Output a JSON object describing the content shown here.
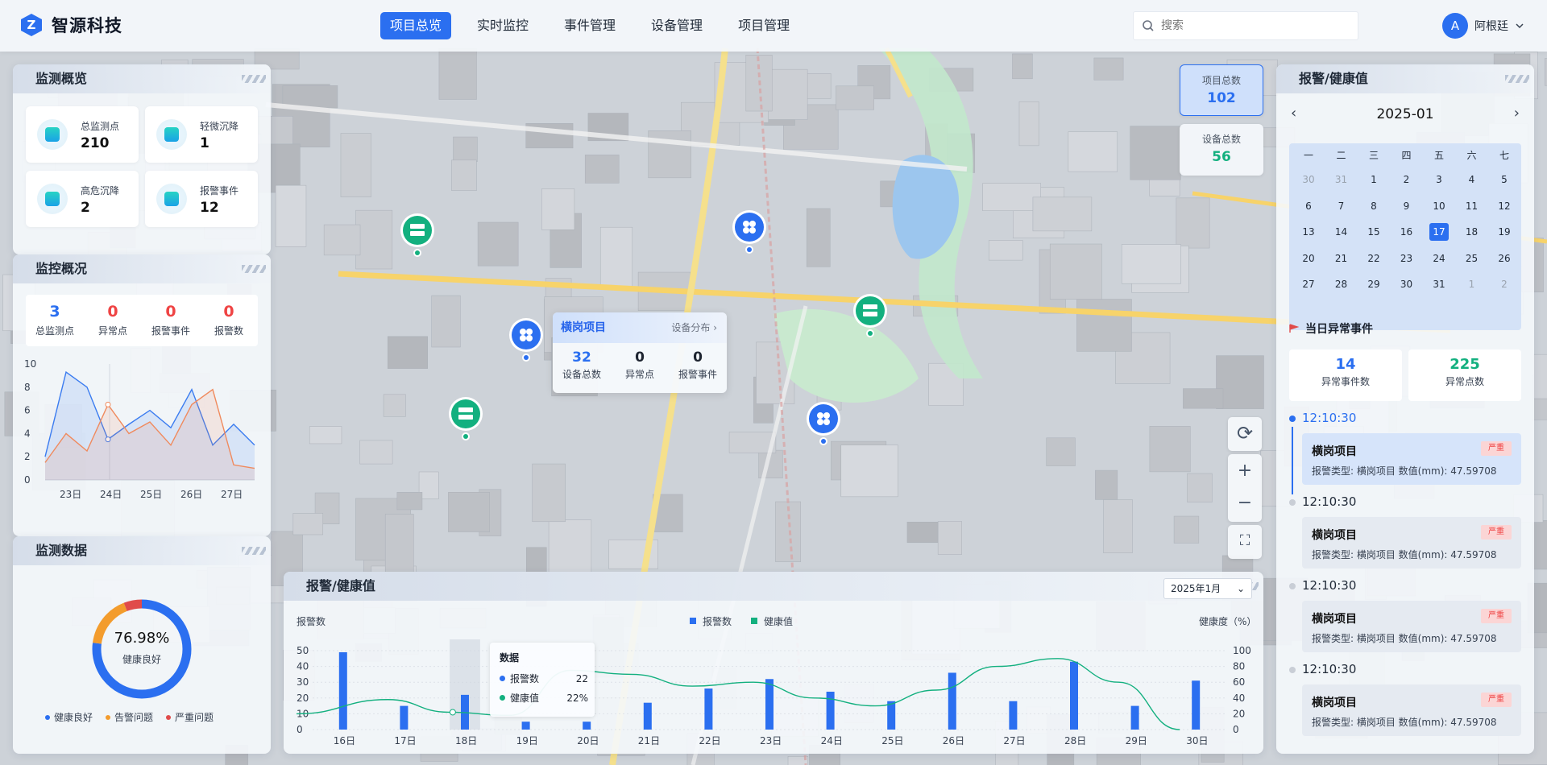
{
  "header": {
    "logo_letter": "Z",
    "app_name": "智源科技",
    "search_placeholder": "搜索",
    "user_initial": "A",
    "user_name": "阿根廷",
    "nav": [
      "项目总览",
      "实时监控",
      "事件管理",
      "设备管理",
      "项目管理"
    ],
    "active_nav": 0
  },
  "overview": {
    "title": "监测概览",
    "cards": [
      {
        "label": "总监测点",
        "value": "210"
      },
      {
        "label": "轻微沉降",
        "value": "1"
      },
      {
        "label": "高危沉降",
        "value": "2"
      },
      {
        "label": "报警事件",
        "value": "12"
      }
    ]
  },
  "monitor": {
    "title": "监控概况",
    "stats": [
      {
        "value": "3",
        "label": "总监测点",
        "color": "#2b6ff0"
      },
      {
        "value": "0",
        "label": "异常点",
        "color": "#ef4444"
      },
      {
        "value": "0",
        "label": "报警事件",
        "color": "#ef4444"
      },
      {
        "value": "0",
        "label": "报警数",
        "color": "#ef4444"
      }
    ],
    "chart": {
      "type": "line",
      "x": [
        "23日",
        "24日",
        "25日",
        "26日",
        "27日"
      ],
      "y_ticks": [
        "10",
        "8",
        "6",
        "4",
        "2",
        "0"
      ],
      "series": [
        {
          "color": "#3b7cf0",
          "values": [
            2,
            9.3,
            8,
            3.5,
            4.8,
            6,
            4.5,
            7.8,
            3,
            4.8,
            3
          ]
        },
        {
          "color": "#f08a5d",
          "values": [
            1.5,
            4,
            2.5,
            6.5,
            4,
            5,
            3,
            6.5,
            7.8,
            1.3,
            1
          ]
        }
      ]
    }
  },
  "monitor_data": {
    "title": "监测数据",
    "percent": "76.98%",
    "percent_label": "健康良好",
    "legend": [
      {
        "label": "健康良好",
        "color": "#2b6ff0"
      },
      {
        "label": "告警问题",
        "color": "#f39c2d"
      },
      {
        "label": "严重问题",
        "color": "#e04b4b"
      }
    ],
    "chart_data": {
      "type": "pie",
      "labels": [
        "健康良好",
        "告警问题",
        "严重问题"
      ],
      "values": [
        76.98,
        17,
        6
      ]
    }
  },
  "map_counts": [
    {
      "label": "项目总数",
      "value": "102",
      "color": "#2b6ff0"
    },
    {
      "label": "设备总数",
      "value": "56",
      "color": "#13b07f"
    }
  ],
  "popup": {
    "title": "横岗项目",
    "link": "设备分布",
    "stats": [
      {
        "value": "32",
        "label": "设备总数",
        "color": "#2b6ff0"
      },
      {
        "value": "0",
        "label": "异常点",
        "color": "#111"
      },
      {
        "value": "0",
        "label": "报警事件",
        "color": "#111"
      }
    ]
  },
  "alarm_panel": {
    "title": "报警/健康值",
    "month": "2025-01",
    "weekdays": [
      "一",
      "二",
      "三",
      "四",
      "五",
      "六",
      "七"
    ],
    "days": [
      "30",
      "31",
      "1",
      "2",
      "3",
      "4",
      "5",
      "6",
      "7",
      "8",
      "9",
      "10",
      "11",
      "12",
      "13",
      "14",
      "15",
      "16",
      "17",
      "18",
      "19",
      "20",
      "21",
      "22",
      "23",
      "24",
      "25",
      "26",
      "27",
      "28",
      "29",
      "30",
      "31",
      "1",
      "2"
    ],
    "selected": "17",
    "event_title": "当日异常事件",
    "event_stats": [
      {
        "value": "14",
        "label": "异常事件数"
      },
      {
        "value": "225",
        "label": "异常点数"
      }
    ],
    "events": [
      {
        "time": "12:10:30",
        "title": "横岗项目",
        "badge": "严重",
        "detail": "报警类型:  横岗项目     数值(mm):  47.59708"
      },
      {
        "time": "12:10:30",
        "title": "横岗项目",
        "badge": "严重",
        "detail": "报警类型:  横岗项目     数值(mm):  47.59708"
      },
      {
        "time": "12:10:30",
        "title": "横岗项目",
        "badge": "严重",
        "detail": "报警类型:  横岗项目     数值(mm):  47.59708"
      },
      {
        "time": "12:10:30",
        "title": "横岗项目",
        "badge": "严重",
        "detail": "报警类型:  横岗项目     数值(mm):  47.59708"
      }
    ]
  },
  "bottom_chart": {
    "title": "报警/健康值",
    "month_select": "2025年1月",
    "y_left_label": "报警数",
    "y_right_label": "健康度（%）",
    "legend": [
      "报警数",
      "健康值"
    ],
    "tooltip": {
      "title": "数据",
      "rows": [
        {
          "label": "报警数",
          "value": "22",
          "color": "#2b6ff0"
        },
        {
          "label": "健康值",
          "value": "22%",
          "color": "#13b07f"
        }
      ]
    },
    "chart_data": {
      "type": "bar",
      "categories": [
        "16日",
        "17日",
        "18日",
        "19日",
        "20日",
        "21日",
        "22日",
        "23日",
        "24日",
        "25日",
        "26日",
        "27日",
        "28日",
        "29日",
        "30日"
      ],
      "series": [
        {
          "name": "报警数",
          "values": [
            49,
            15,
            22,
            5,
            5,
            17,
            26,
            32,
            24,
            18,
            36,
            18,
            43,
            15,
            31
          ]
        },
        {
          "name": "健康值",
          "values": [
            20,
            38,
            22,
            18,
            75,
            70,
            55,
            60,
            40,
            30,
            50,
            80,
            90,
            60,
            0
          ]
        }
      ],
      "ylim_left": [
        0,
        50
      ],
      "ylim_right": [
        0,
        100
      ],
      "left_ticks": [
        "50",
        "40",
        "30",
        "20",
        "10",
        "0"
      ],
      "right_ticks": [
        "100",
        "80",
        "60",
        "40",
        "20",
        "0"
      ]
    }
  }
}
